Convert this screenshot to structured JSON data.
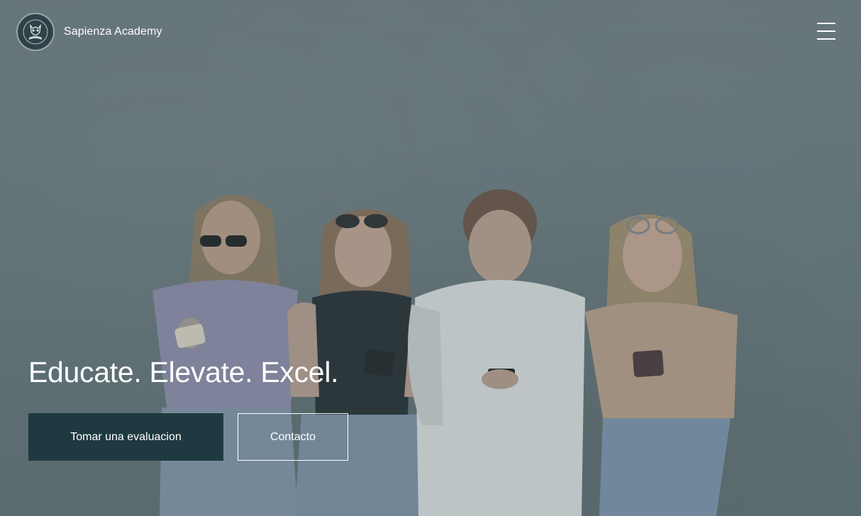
{
  "brand": {
    "name": "Sapienza Academy",
    "logo_icon": "owl-emblem-icon"
  },
  "nav": {
    "menu_icon": "hamburger-menu-icon"
  },
  "hero": {
    "headline": "Educate. Elevate. Excel.",
    "background_description_icon": "students-with-phones-photo",
    "primary_cta": "Tomar una evaluacion",
    "secondary_cta": "Contacto"
  },
  "colors": {
    "primary_button": "#1e3a40",
    "overlay": "#66777b",
    "text": "#ffffff"
  }
}
